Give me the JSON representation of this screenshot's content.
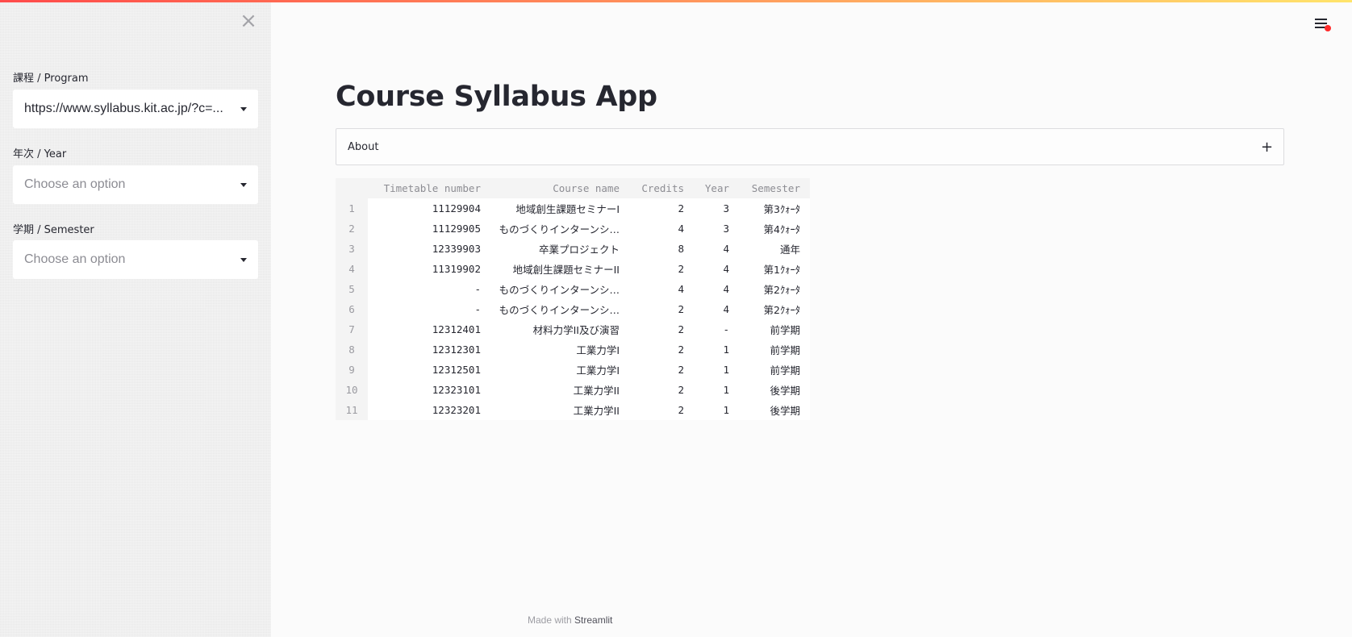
{
  "app": {
    "title": "Course Syllabus App"
  },
  "sidebar": {
    "close_icon": "×",
    "fields": [
      {
        "label": "課程 / Program",
        "value": "https://www.syllabus.kit.ac.jp/?c=...",
        "placeholder": ""
      },
      {
        "label": "年次 / Year",
        "value": "",
        "placeholder": "Choose an option"
      },
      {
        "label": "学期 / Semester",
        "value": "",
        "placeholder": "Choose an option"
      }
    ]
  },
  "expander": {
    "label": "About",
    "icon": "+"
  },
  "table": {
    "columns": [
      "Timetable number",
      "Course name",
      "Credits",
      "Year",
      "Semester"
    ],
    "rows": [
      {
        "index": "1",
        "timetable": "11129904",
        "course": "地域創生課題セミナーI",
        "credits": "2",
        "year": "3",
        "semester": "第3ｸｫｰﾀ"
      },
      {
        "index": "2",
        "timetable": "11129905",
        "course": "ものづくりインターンシ…",
        "credits": "4",
        "year": "3",
        "semester": "第4ｸｫｰﾀ"
      },
      {
        "index": "3",
        "timetable": "12339903",
        "course": "卒業プロジェクト",
        "credits": "8",
        "year": "4",
        "semester": "通年"
      },
      {
        "index": "4",
        "timetable": "11319902",
        "course": "地域創生課題セミナーII",
        "credits": "2",
        "year": "4",
        "semester": "第1ｸｫｰﾀ"
      },
      {
        "index": "5",
        "timetable": "-",
        "course": "ものづくりインターンシ…",
        "credits": "4",
        "year": "4",
        "semester": "第2ｸｫｰﾀ"
      },
      {
        "index": "6",
        "timetable": "-",
        "course": "ものづくりインターンシ…",
        "credits": "2",
        "year": "4",
        "semester": "第2ｸｫｰﾀ"
      },
      {
        "index": "7",
        "timetable": "12312401",
        "course": "材料力学II及び演習",
        "credits": "2",
        "year": "-",
        "semester": "前学期"
      },
      {
        "index": "8",
        "timetable": "12312301",
        "course": "工業力学I",
        "credits": "2",
        "year": "1",
        "semester": "前学期"
      },
      {
        "index": "9",
        "timetable": "12312501",
        "course": "工業力学I",
        "credits": "2",
        "year": "1",
        "semester": "前学期"
      },
      {
        "index": "10",
        "timetable": "12323101",
        "course": "工業力学II",
        "credits": "2",
        "year": "1",
        "semester": "後学期"
      },
      {
        "index": "11",
        "timetable": "12323201",
        "course": "工業力学II",
        "credits": "2",
        "year": "1",
        "semester": "後学期"
      }
    ]
  },
  "footer": {
    "prefix": "Made with",
    "brand": "Streamlit"
  },
  "colors": {
    "accent": "#ff4b4b",
    "sidebar_bg": "#efefef",
    "main_bg": "#fbfbfb"
  }
}
